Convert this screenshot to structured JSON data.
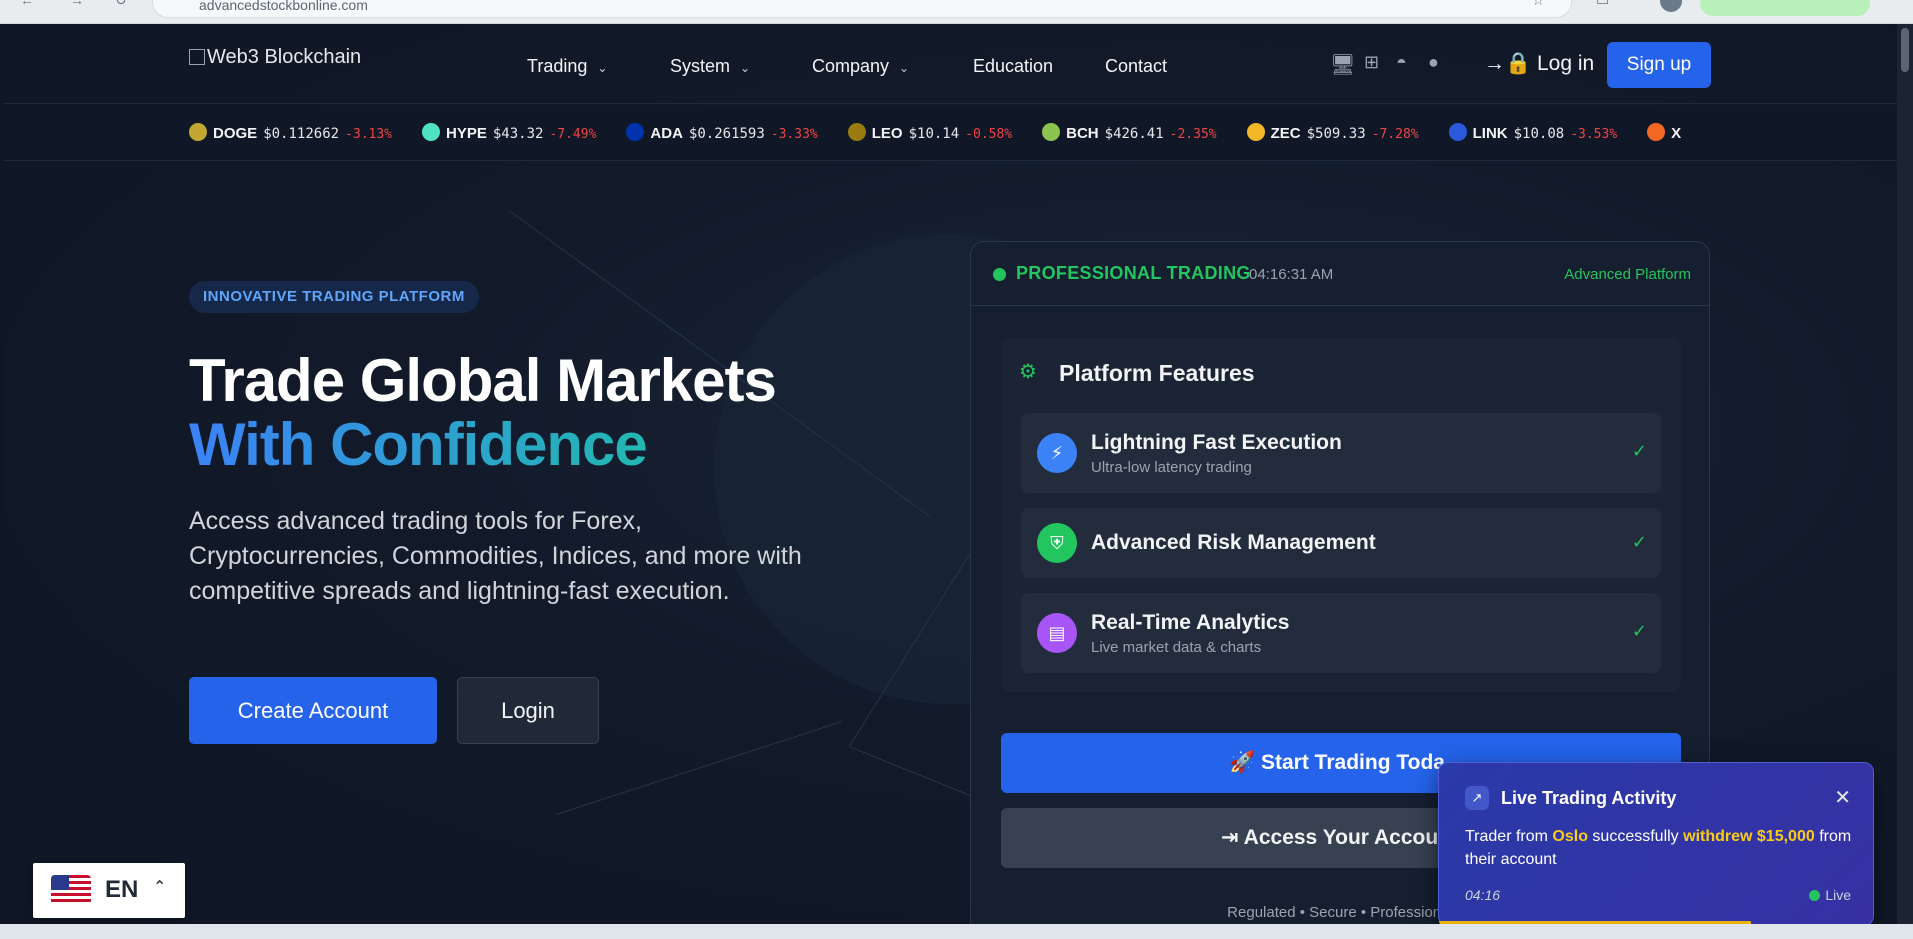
{
  "browser": {
    "url": "advancedstockbonline.com"
  },
  "nav": {
    "logo_alt": "Web3 Blockchain",
    "links": [
      {
        "label": "Trading",
        "dropdown": true
      },
      {
        "label": "System",
        "dropdown": true
      },
      {
        "label": "Company",
        "dropdown": true
      },
      {
        "label": "Education",
        "dropdown": false
      },
      {
        "label": "Contact",
        "dropdown": false
      }
    ],
    "platform_icons": [
      "desktop-icon",
      "windows-icon",
      "android-icon",
      "apple-icon"
    ],
    "login_label": "Log in",
    "signup_label": "Sign up"
  },
  "ticker": [
    {
      "symbol": "DOGE",
      "price": "$0.112662",
      "change": "-3.13%",
      "color": "#c2a633"
    },
    {
      "symbol": "HYPE",
      "price": "$43.32",
      "change": "-7.49%",
      "color": "#50e3c2"
    },
    {
      "symbol": "ADA",
      "price": "$0.261593",
      "change": "-3.33%",
      "color": "#0033ad"
    },
    {
      "symbol": "LEO",
      "price": "$10.14",
      "change": "-0.58%",
      "color": "#9a7b12"
    },
    {
      "symbol": "BCH",
      "price": "$426.41",
      "change": "-2.35%",
      "color": "#8dc351"
    },
    {
      "symbol": "ZEC",
      "price": "$509.33",
      "change": "-7.28%",
      "color": "#f4b728"
    },
    {
      "symbol": "LINK",
      "price": "$10.08",
      "change": "-3.53%",
      "color": "#2a5ada"
    },
    {
      "symbol": "X",
      "price": "",
      "change": "",
      "color": "#f26822"
    }
  ],
  "hero": {
    "badge": "INNOVATIVE TRADING PLATFORM",
    "title_line1": "Trade Global Markets",
    "title_line2": "With Confidence",
    "description": "Access advanced trading tools for Forex, Cryptocurrencies, Commodities, Indices, and more with competitive spreads and lightning-fast execution.",
    "create_account": "Create Account",
    "login": "Login"
  },
  "panel": {
    "status": "PROFESSIONAL TRADING",
    "time": "04:16:31 AM",
    "platform": "Advanced Platform",
    "features_title": "Platform Features",
    "features": [
      {
        "title": "Lightning Fast Execution",
        "subtitle": "Ultra-low latency trading",
        "color": "#3b82f6"
      },
      {
        "title": "Advanced Risk Management",
        "subtitle": "",
        "color": "#22c55e"
      },
      {
        "title": "Real-Time Analytics",
        "subtitle": "Live market data & charts",
        "color": "#a855f7"
      }
    ],
    "start_trading": "Start Trading Toda",
    "access_account": "Access Your Accou",
    "footer": "Regulated • Secure • Professional"
  },
  "toast": {
    "title": "Live Trading Activity",
    "msg_prefix": "Trader from ",
    "city": "Oslo",
    "msg_mid": " successfully ",
    "action": "withdrew $15,000",
    "msg_suffix": " from their account",
    "time": "04:16",
    "live": "Live",
    "progress": 0.72
  },
  "language": {
    "code": "EN"
  }
}
